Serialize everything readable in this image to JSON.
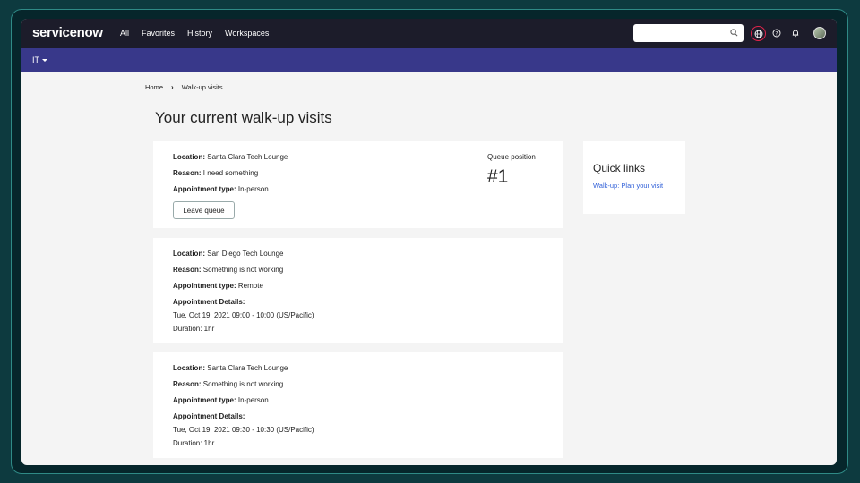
{
  "topbar": {
    "logo": "servicenow",
    "nav": [
      "All",
      "Favorites",
      "History",
      "Workspaces"
    ],
    "search_value": "",
    "icons": [
      "search-icon",
      "globe-icon",
      "help-icon",
      "bell-icon",
      "avatar"
    ],
    "accent_color": "#e0244b"
  },
  "subbar": {
    "menu_label": "IT"
  },
  "breadcrumb": {
    "home": "Home",
    "current": "Walk-up visits"
  },
  "page": {
    "title": "Your current walk-up visits"
  },
  "visits": [
    {
      "location_label": "Location:",
      "location": "Santa Clara Tech Lounge",
      "reason_label": "Reason:",
      "reason": "I need something",
      "type_label": "Appointment type:",
      "type": "In-person",
      "leave_label": "Leave queue",
      "queue_label": "Queue position",
      "queue_value": "#1"
    },
    {
      "location_label": "Location:",
      "location": "San Diego Tech Lounge",
      "reason_label": "Reason:",
      "reason": "Something is not working",
      "type_label": "Appointment type:",
      "type": "Remote",
      "details_label": "Appointment Details:",
      "details_time": "Tue, Oct 19, 2021 09:00 - 10:00 (US/Pacific)",
      "duration": "Duration: 1hr"
    },
    {
      "location_label": "Location:",
      "location": "Santa Clara Tech Lounge",
      "reason_label": "Reason:",
      "reason": "Something is not working",
      "type_label": "Appointment type:",
      "type": "In-person",
      "details_label": "Appointment Details:",
      "details_time": "Tue, Oct 19, 2021 09:30 - 10:30 (US/Pacific)",
      "duration": "Duration: 1hr"
    }
  ],
  "quick_links": {
    "title": "Quick links",
    "link": "Walk-up: Plan your visit",
    "link_color": "#2f5fd8"
  }
}
